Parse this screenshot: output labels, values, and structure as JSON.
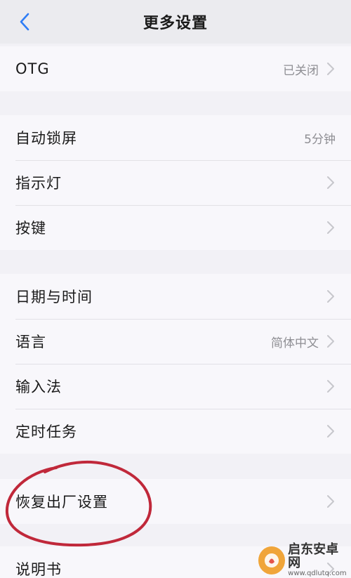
{
  "header": {
    "title": "更多设置",
    "back_icon": "chevron-left-icon",
    "accent": "#2f7df6"
  },
  "groups": [
    {
      "rows": [
        {
          "label": "OTG",
          "value": "已关闭",
          "chevron": true
        }
      ]
    },
    {
      "rows": [
        {
          "label": "自动锁屏",
          "value": "5分钟",
          "chevron": false
        },
        {
          "label": "指示灯",
          "value": "",
          "chevron": true
        },
        {
          "label": "按键",
          "value": "",
          "chevron": true
        }
      ]
    },
    {
      "rows": [
        {
          "label": "日期与时间",
          "value": "",
          "chevron": true
        },
        {
          "label": "语言",
          "value": "简体中文",
          "chevron": true
        },
        {
          "label": "输入法",
          "value": "",
          "chevron": true
        },
        {
          "label": "定时任务",
          "value": "",
          "chevron": true
        }
      ]
    },
    {
      "rows": [
        {
          "label": "恢复出厂设置",
          "value": "",
          "chevron": true
        }
      ]
    },
    {
      "rows": [
        {
          "label": "说明书",
          "value": "",
          "chevron": true
        }
      ]
    }
  ],
  "annotation": {
    "shape": "hand-drawn-circle",
    "color": "#c0283a",
    "target": "恢复出厂设置"
  },
  "watermark": {
    "main": "启东安卓网",
    "sub": "www.qdlutq.com"
  }
}
